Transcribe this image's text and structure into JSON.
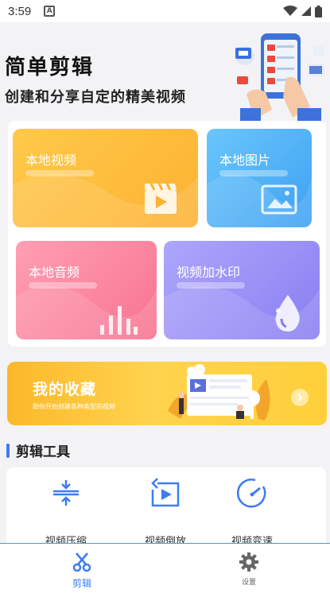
{
  "status_bar": {
    "time": "3:59",
    "notification_badge": "A",
    "icons": [
      "notification-icon",
      "wifi-icon",
      "cellular-signal-icon",
      "battery-icon"
    ]
  },
  "header": {
    "title": "简单剪辑",
    "subtitle": "创建和分享自定的精美视频",
    "hero_icon": "phone-hand-illustration"
  },
  "media_cards": [
    {
      "label": "本地视频",
      "icon": "clapperboard-play-icon",
      "color": "#fdb232"
    },
    {
      "label": "本地图片",
      "icon": "picture-icon",
      "color": "#3ea1f2"
    },
    {
      "label": "本地音频",
      "icon": "audio-bars-icon",
      "color": "#f87390"
    },
    {
      "label": "视频加水印",
      "icon": "water-drop-icon",
      "color": "#8a7ef2"
    }
  ],
  "favorites": {
    "title": "我的收藏",
    "subtitle": "助你开始创建各种类型的视频",
    "arrow_icon": "chevron-right-icon"
  },
  "tools_section": {
    "title": "剪辑工具",
    "accent_color": "#3d7bf7",
    "tools": [
      {
        "label": "视频压缩",
        "icon": "compress-icon"
      },
      {
        "label": "视频倒放",
        "icon": "reverse-play-icon"
      },
      {
        "label": "视频变速",
        "icon": "speed-gauge-icon"
      }
    ]
  },
  "bottom_nav": {
    "items": [
      {
        "label": "剪辑",
        "icon": "scissors-icon",
        "active": true
      },
      {
        "label": "设置",
        "icon": "gear-icon",
        "active": false
      }
    ],
    "active_color": "#3d7bf7"
  }
}
